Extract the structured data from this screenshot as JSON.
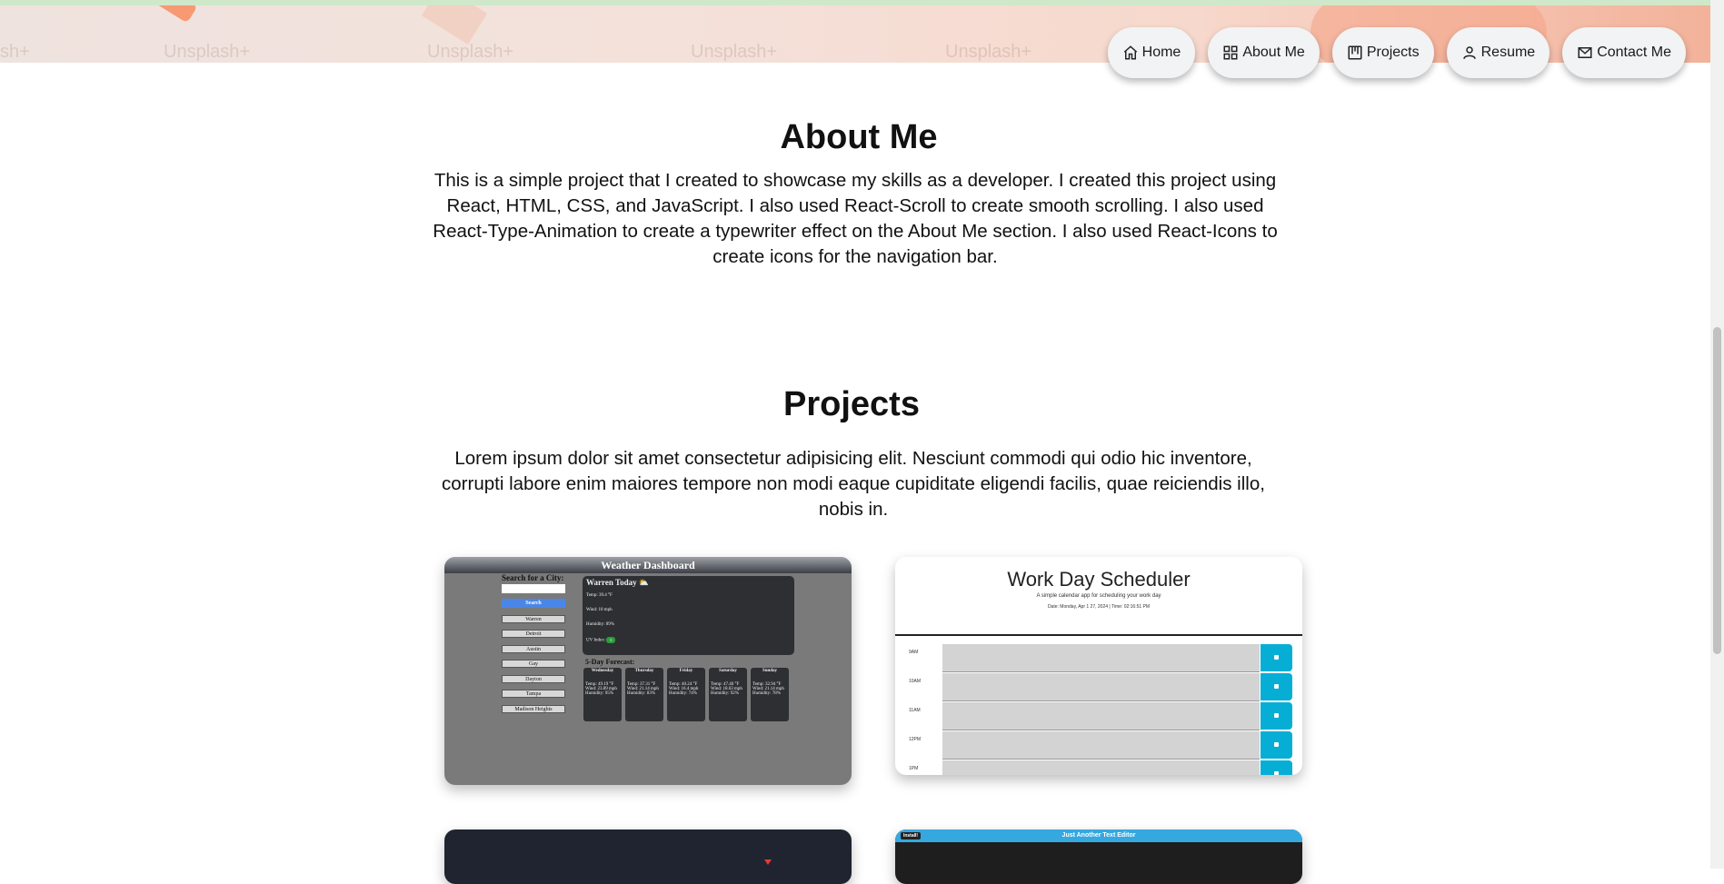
{
  "hero": {
    "ghost_texts": [
      "sh+",
      "Unsplash+",
      "Unsplash+",
      "Unsplash+",
      "Unsplash+"
    ]
  },
  "nav": [
    {
      "label": "Home",
      "icon": "home-icon"
    },
    {
      "label": "About Me",
      "icon": "grid-icon"
    },
    {
      "label": "Projects",
      "icon": "kanban-icon"
    },
    {
      "label": "Resume",
      "icon": "user-icon"
    },
    {
      "label": "Contact Me",
      "icon": "mail-icon"
    }
  ],
  "about": {
    "title": "About Me",
    "text": "This is a simple project that I created to showcase my skills as a developer. I created this project using React, HTML, CSS, and JavaScript. I also used React-Scroll to create smooth scrolling. I also used React-Type-Animation to create a typewriter effect on the About Me section. I also used React-Icons to create icons for the navigation bar."
  },
  "projects": {
    "title": "Projects",
    "text": "Lorem ipsum dolor sit amet consectetur adipisicing elit. Nesciunt commodi qui odio hic inventore, corrupti labore enim maiores tempore non modi eaque cupiditate eligendi facilis, quae reiciendis illo, nobis in."
  },
  "weather": {
    "title": "Weather Dashboard",
    "search_label": "Search for a City:",
    "search_button": "Search",
    "cities": [
      "Warren",
      "Detroit",
      "Austin",
      "Gay",
      "Dayton",
      "Tampa",
      "Madison Heights"
    ],
    "today_title": "Warren Today ⛅",
    "temp": "Temp: 39.4 °F",
    "wind": "Wind: 10 mph",
    "humidity": "Humidity: 89%",
    "uv": "UV Index:",
    "uv_value": "0",
    "forecast_title": "5-Day Forecast:",
    "forecast": [
      {
        "day": "Wednesday",
        "text": "Temp: 49.19 °F Wind: 23.89 mph Humidity: 95%"
      },
      {
        "day": "Thursday",
        "text": "Temp: 37.31 °F Wind: 21.14 mph Humidity: 83%"
      },
      {
        "day": "Friday",
        "text": "Temp: 40.24 °F Wind: 16.4 mph Humidity: 74%"
      },
      {
        "day": "Saturday",
        "text": "Temp: 47.46 °F Wind: 18.63 mph Humidity: 92%"
      },
      {
        "day": "Sunday",
        "text": "Temp: 32.94 °F Wind: 21.14 mph Humidity: 78%"
      }
    ]
  },
  "scheduler": {
    "title": "Work Day Scheduler",
    "subtitle": "A simple calendar app for scheduling your work day",
    "date": "Date: Monday, Apr 1 27, 2024 | Time: 02:16:51 PM",
    "hours": [
      "9AM",
      "10AM",
      "11AM",
      "12PM",
      "1PM"
    ]
  },
  "editor": {
    "title": "Just Another Text Editor",
    "install": "Install!"
  }
}
